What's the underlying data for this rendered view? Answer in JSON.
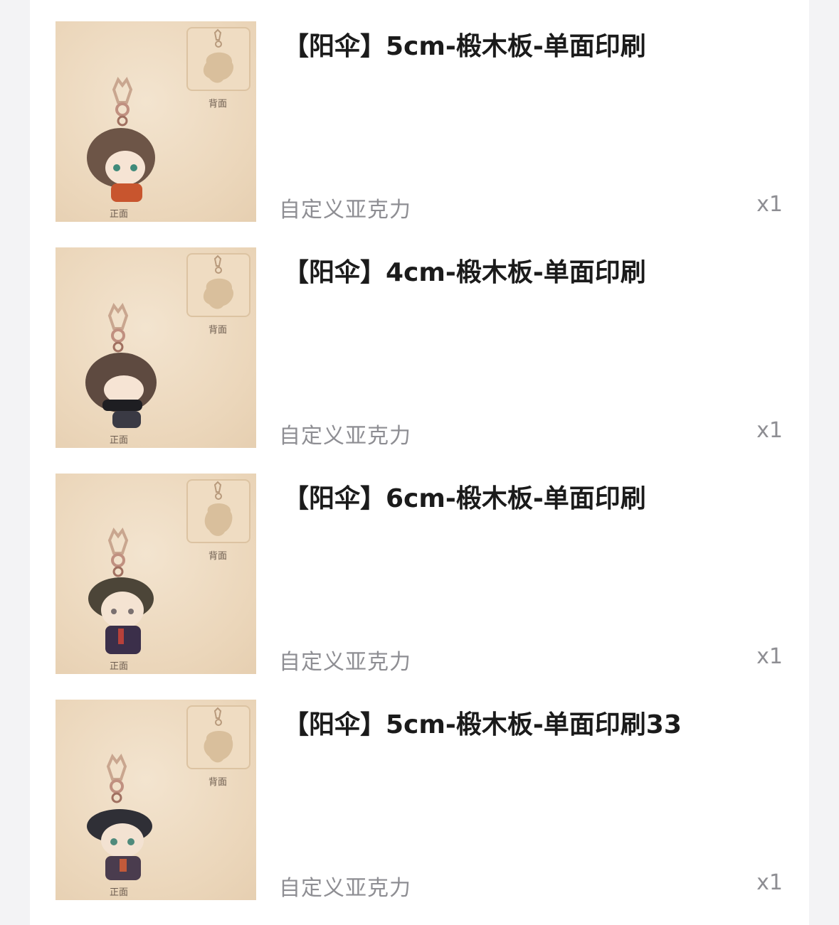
{
  "items": [
    {
      "title": "【阳伞】5cm-椴木板-单面印刷",
      "variant": "自定义亚克力",
      "qty": "x1",
      "front_label": "正面",
      "back_label": "背面",
      "hair": "#6d5547",
      "outfit": "#c8552e"
    },
    {
      "title": "【阳伞】4cm-椴木板-单面印刷",
      "variant": "自定义亚克力",
      "qty": "x1",
      "front_label": "正面",
      "back_label": "背面",
      "hair": "#5e4a40",
      "outfit": "#3a3a44"
    },
    {
      "title": "【阳伞】6cm-椴木板-单面印刷",
      "variant": "自定义亚克力",
      "qty": "x1",
      "front_label": "正面",
      "back_label": "背面",
      "hair": "#4c4538",
      "outfit": "#3b2f4a"
    },
    {
      "title": "【阳伞】5cm-椴木板-单面印刷33",
      "variant": "自定义亚克力",
      "qty": "x1",
      "front_label": "正面",
      "back_label": "背面",
      "hair": "#2f2f36",
      "outfit": "#4a3c4e"
    }
  ]
}
